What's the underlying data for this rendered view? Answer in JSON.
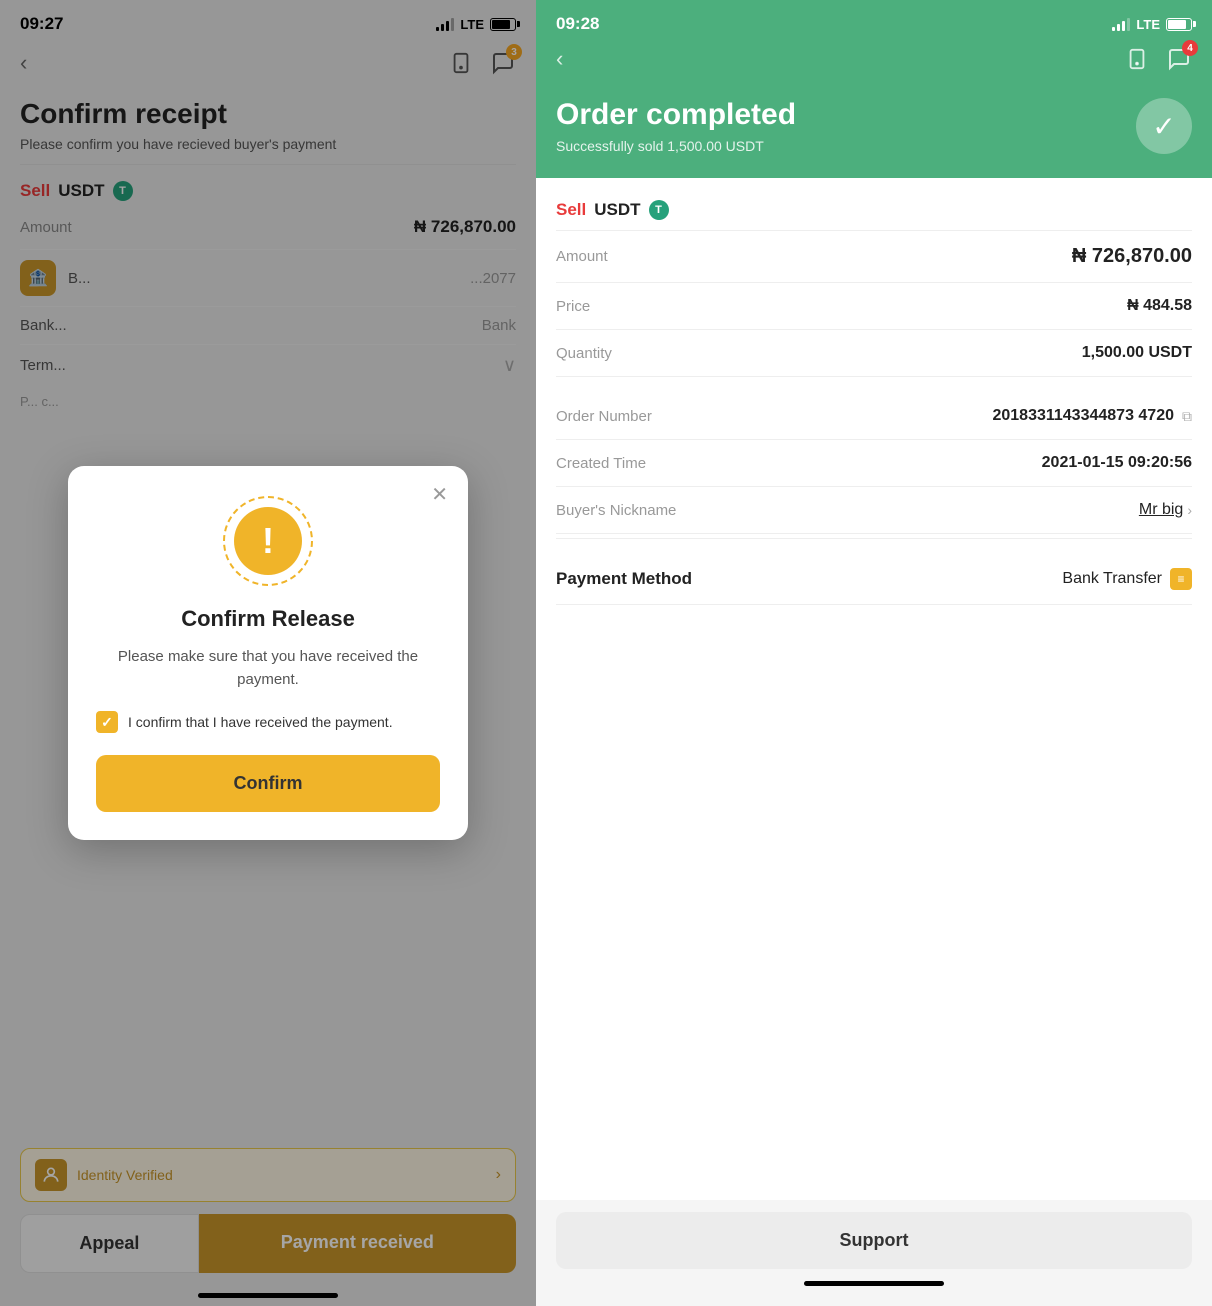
{
  "left": {
    "status": {
      "time": "09:27",
      "location_arrow": "↗",
      "lte": "LTE"
    },
    "page_title": "Confirm receipt",
    "page_subtitle": "Please confirm you have recieved buyer's payment",
    "sell_label": "Sell",
    "coin": "USDT",
    "amount_label": "Amount",
    "amount_value": "₦ 726,870.00",
    "identity_text": "Identity Verified",
    "btn_appeal": "Appeal",
    "btn_payment": "Payment received"
  },
  "modal": {
    "title": "Confirm Release",
    "description": "Please make sure that you have received the payment.",
    "checkbox_label": "I confirm that I have received the payment.",
    "confirm_btn": "Confirm"
  },
  "right": {
    "status": {
      "time": "09:28",
      "location_arrow": "↗",
      "lte": "LTE"
    },
    "header_title": "Order completed",
    "header_subtitle": "Successfully sold 1,500.00 USDT",
    "sell_label": "Sell",
    "coin": "USDT",
    "amount_label": "Amount",
    "amount_value": "₦ 726,870.00",
    "price_label": "Price",
    "price_value": "₦ 484.58",
    "quantity_label": "Quantity",
    "quantity_value": "1,500.00 USDT",
    "order_number_label": "Order Number",
    "order_number_value": "2018331143344873 4720",
    "created_time_label": "Created Time",
    "created_time_value": "2021-01-15 09:20:56",
    "buyer_nickname_label": "Buyer's Nickname",
    "buyer_nickname_value": "Mr big",
    "payment_method_label": "Payment Method",
    "payment_method_value": "Bank Transfer",
    "btn_support": "Support",
    "badge_count": "4"
  }
}
